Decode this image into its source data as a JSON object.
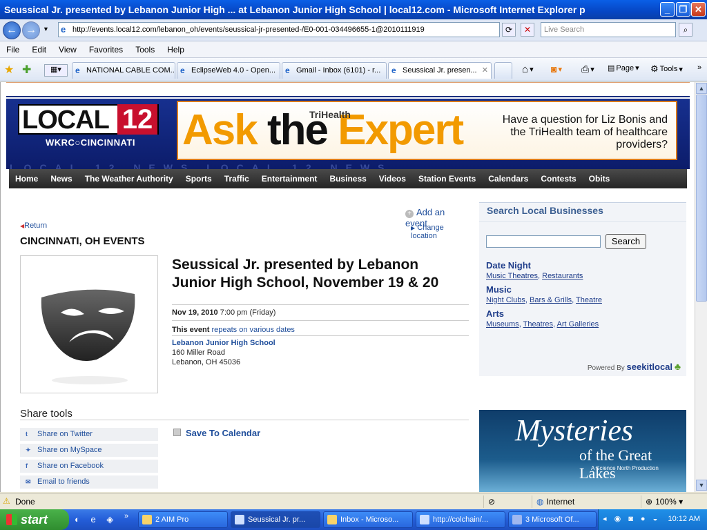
{
  "window": {
    "title": "Seussical Jr. presented by Lebanon Junior High ... at Lebanon Junior High School | local12.com - Microsoft Internet Explorer p"
  },
  "address": {
    "url": "http://events.local12.com/lebanon_oh/events/seussical-jr-presented-/E0-001-034496655-1@2010111919",
    "search_placeholder": "Live Search"
  },
  "menu": [
    "File",
    "Edit",
    "View",
    "Favorites",
    "Tools",
    "Help"
  ],
  "tabs": [
    {
      "label": "NATIONAL CABLE COM...",
      "active": false
    },
    {
      "label": "EclipseWeb 4.0 - Open...",
      "active": false
    },
    {
      "label": "Gmail - Inbox (6101) - r...",
      "active": false
    },
    {
      "label": "Seussical Jr. presen...",
      "active": true
    }
  ],
  "toolbar_right": {
    "page": "Page",
    "tools": "Tools"
  },
  "site": {
    "logo_main": "LOCAL",
    "logo_num": "12",
    "logo_sub": "WKRC○CINCINNATI",
    "ad_ask": "Ask",
    "ad_the": "the",
    "ad_expert": "Expert",
    "ad_brand": "TriHealth",
    "ad_copy": "Have a question for Liz Bonis and the TriHealth team of healthcare providers?",
    "watermark": "LOCAL 12 NEWS LOCAL 12 NEWS",
    "nav": [
      "Home",
      "News",
      "The Weather Authority",
      "Sports",
      "Traffic",
      "Entertainment",
      "Business",
      "Videos",
      "Station Events",
      "Calendars",
      "Contests",
      "Obits"
    ]
  },
  "event": {
    "add_event": "Add an event",
    "return": "Return",
    "change_location": "Change location",
    "city_heading": "CINCINNATI, OH EVENTS",
    "title": "Seussical Jr. presented by Lebanon Junior High School, November 19 & 20",
    "date": "Nov 19, 2010",
    "time": "7:00 pm (Friday)",
    "repeat_prefix": "This event",
    "repeat_link": "repeats on various dates",
    "venue_name": "Lebanon Junior High School",
    "venue_street": "160 Miller Road",
    "venue_city": "Lebanon, OH 45036",
    "share_heading": "Share tools",
    "share_items": [
      "Share on Twitter",
      "Share on MySpace",
      "Share on Facebook",
      "Email to friends"
    ],
    "save_calendar": "Save To Calendar"
  },
  "sidebar": {
    "heading": "Search Local Businesses",
    "search_button": "Search",
    "categories": [
      {
        "name": "Date Night",
        "links": [
          "Music Theatres",
          "Restaurants"
        ]
      },
      {
        "name": "Music",
        "links": [
          "Night Clubs",
          "Bars & Grills",
          "Theatre"
        ]
      },
      {
        "name": "Arts",
        "links": [
          "Museums",
          "Theatres",
          "Art Galleries"
        ]
      }
    ],
    "powered_prefix": "Powered By",
    "powered_brand": "seekitlocal"
  },
  "promo": {
    "line1": "Mysteries",
    "line2": "of the Great Lakes",
    "line3": "A Science North Production"
  },
  "status": {
    "text": "Done",
    "zone": "Internet",
    "zoom": "100%"
  },
  "taskbar": {
    "start": "start",
    "tasks": [
      "2 AIM Pro",
      "Seussical Jr. pr...",
      "Inbox - Microso...",
      "http://colchain/...",
      "3 Microsoft Of..."
    ],
    "clock": "10:12 AM"
  }
}
